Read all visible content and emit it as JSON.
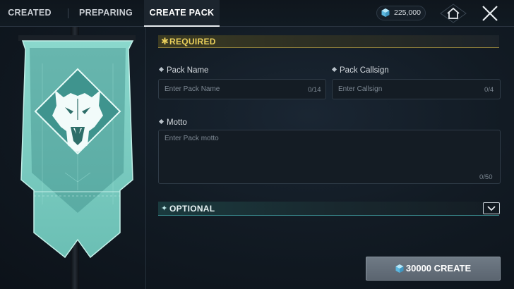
{
  "tabs": [
    {
      "label": "CREATED",
      "active": false
    },
    {
      "label": "PREPARING",
      "active": false
    },
    {
      "label": "CREATE PACK",
      "active": true
    }
  ],
  "currency": {
    "icon": "gem-icon",
    "amount": "225,000"
  },
  "header_icons": [
    "home-icon",
    "close-icon"
  ],
  "banner": {
    "emblem": "wolf-head-emblem",
    "color": "#7ecfc4"
  },
  "required": {
    "marker": "✱",
    "label": "REQUIRED"
  },
  "fields": {
    "pack_name": {
      "label": "Pack Name",
      "placeholder": "Enter Pack Name",
      "counter": "0/14"
    },
    "pack_callsign": {
      "label": "Pack Callsign",
      "placeholder": "Enter Callsign",
      "counter": "0/4"
    },
    "motto": {
      "label": "Motto",
      "placeholder": "Enter Pack motto",
      "counter": "0/50"
    }
  },
  "optional": {
    "marker": "✦",
    "label": "OPTIONAL",
    "expand_icon": "chevron-down-icon"
  },
  "create_button": {
    "icon": "gem-icon",
    "label": "30000 CREATE"
  },
  "colors": {
    "required_accent": "#e9cf5b",
    "optional_accent": "#3a8d90",
    "gem": "#6ec6e6"
  }
}
